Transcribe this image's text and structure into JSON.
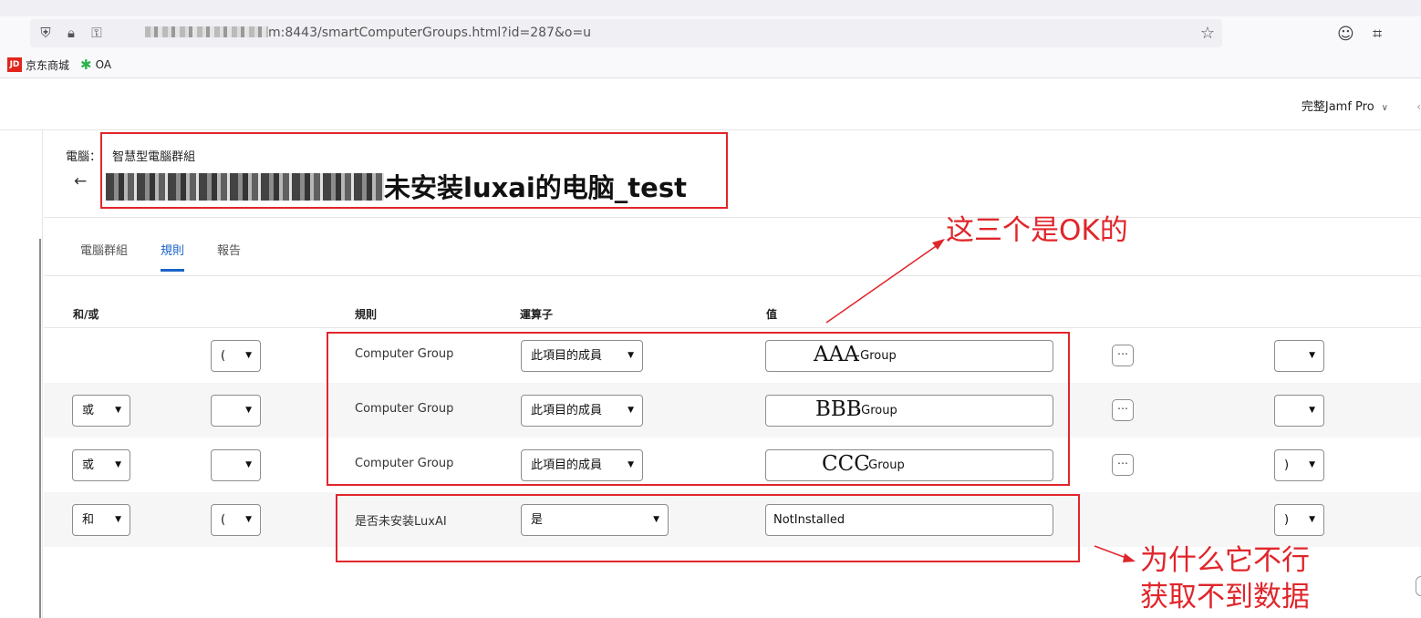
{
  "browser": {
    "url_prefix_hidden": "",
    "url_suffix": "m:8443/smartComputerGroups.html?id=287&o=u",
    "bookmarks": [
      {
        "label": "京东商城",
        "icon": "jd-icon"
      },
      {
        "label": "OA",
        "icon": "oa-gear-icon"
      }
    ],
    "jd_logo_text": "JD"
  },
  "header": {
    "env_label": "完整Jamf Pro"
  },
  "page": {
    "breadcrumb_root": "電腦：",
    "breadcrumb_current": "智慧型電腦群組",
    "title_visible": "未安装luxai的电脑_test"
  },
  "tabs": [
    {
      "label": "電腦群組",
      "active": false
    },
    {
      "label": "規則",
      "active": true
    },
    {
      "label": "報告",
      "active": false
    }
  ],
  "table": {
    "headers": {
      "andor": "和/或",
      "rule": "規則",
      "operator": "運算子",
      "value": "值"
    },
    "rows": [
      {
        "andor": "",
        "open_paren": "(",
        "rule": "Computer Group",
        "operator": "此項目的成員",
        "value_big": "AAA",
        "value_small": "-Group",
        "value_plain": "",
        "has_more": true,
        "close_paren": ""
      },
      {
        "andor": "或",
        "open_paren": "",
        "rule": "Computer Group",
        "operator": "此項目的成員",
        "value_big": "BBB",
        "value_small": "-Group",
        "value_plain": "",
        "has_more": true,
        "close_paren": ""
      },
      {
        "andor": "或",
        "open_paren": "",
        "rule": "Computer Group",
        "operator": "此項目的成員",
        "value_big": "CCC",
        "value_small": "-Group",
        "value_plain": "",
        "has_more": true,
        "close_paren": ")"
      },
      {
        "andor": "和",
        "open_paren": "(",
        "rule": "是否未安装LuxAI",
        "operator": "是",
        "value_big": "",
        "value_small": "",
        "value_plain": "NotInstalled",
        "has_more": false,
        "close_paren": ")"
      }
    ]
  },
  "annotations": {
    "ok_note": "这三个是OK的",
    "why_line1": "为什么它不行",
    "why_line2": "获取不到数据",
    "color": "#e0262b"
  }
}
